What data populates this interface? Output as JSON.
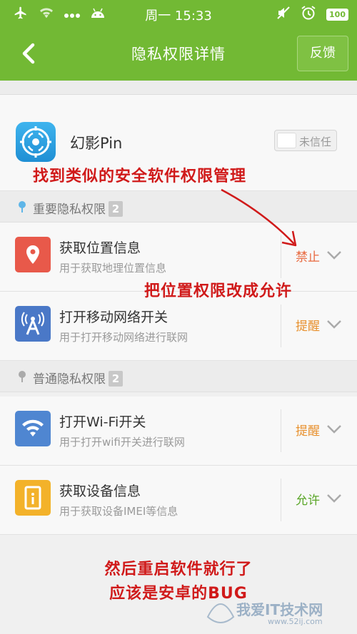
{
  "status_bar": {
    "time": "周一 15:33",
    "battery": "100",
    "left_icons": [
      "airplane-icon",
      "wifi-icon",
      "more-dots-icon",
      "android-icon"
    ],
    "right_icons": [
      "mute-icon",
      "alarm-icon",
      "battery-icon"
    ]
  },
  "header": {
    "title": "隐私权限详情",
    "back_icon": "back-arrow-icon",
    "feedback_label": "反馈"
  },
  "app": {
    "name": "幻影Pin",
    "trust_label": "未信任",
    "trusted": false
  },
  "sections": [
    {
      "title": "重要隐私权限",
      "count": "2",
      "items": [
        {
          "title": "获取位置信息",
          "desc": "用于获取地理位置信息",
          "status": "禁止",
          "status_color": "#e8693f",
          "icon": "location-pin-icon",
          "icon_color": "#e8594a"
        },
        {
          "title": "打开移动网络开关",
          "desc": "用于打开移动网络进行联网",
          "status": "提醒",
          "status_color": "#e8912f",
          "icon": "cell-tower-icon",
          "icon_color": "#4a78c7"
        }
      ]
    },
    {
      "title": "普通隐私权限",
      "count": "2",
      "items": [
        {
          "title": "打开Wi-Fi开关",
          "desc": "用于打开wifi开关进行联网",
          "status": "提醒",
          "status_color": "#e8912f",
          "icon": "wifi-signal-icon",
          "icon_color": "#4f86d1"
        },
        {
          "title": "获取设备信息",
          "desc": "用于获取设备IMEI等信息",
          "status": "允许",
          "status_color": "#5aa628",
          "icon": "device-info-icon",
          "icon_color": "#f3b22a"
        }
      ]
    }
  ],
  "annotations": {
    "line1": "找到类似的安全软件权限管理",
    "line2": "把位置权限改成允许",
    "line3": "然后重启软件就行了",
    "line4": "应该是安卓的BUG",
    "color": "#d01a1a"
  },
  "watermark": {
    "text": "我爱IT技术网",
    "url": "www.52ij.com"
  },
  "colors": {
    "brand_green": "#72b934"
  }
}
